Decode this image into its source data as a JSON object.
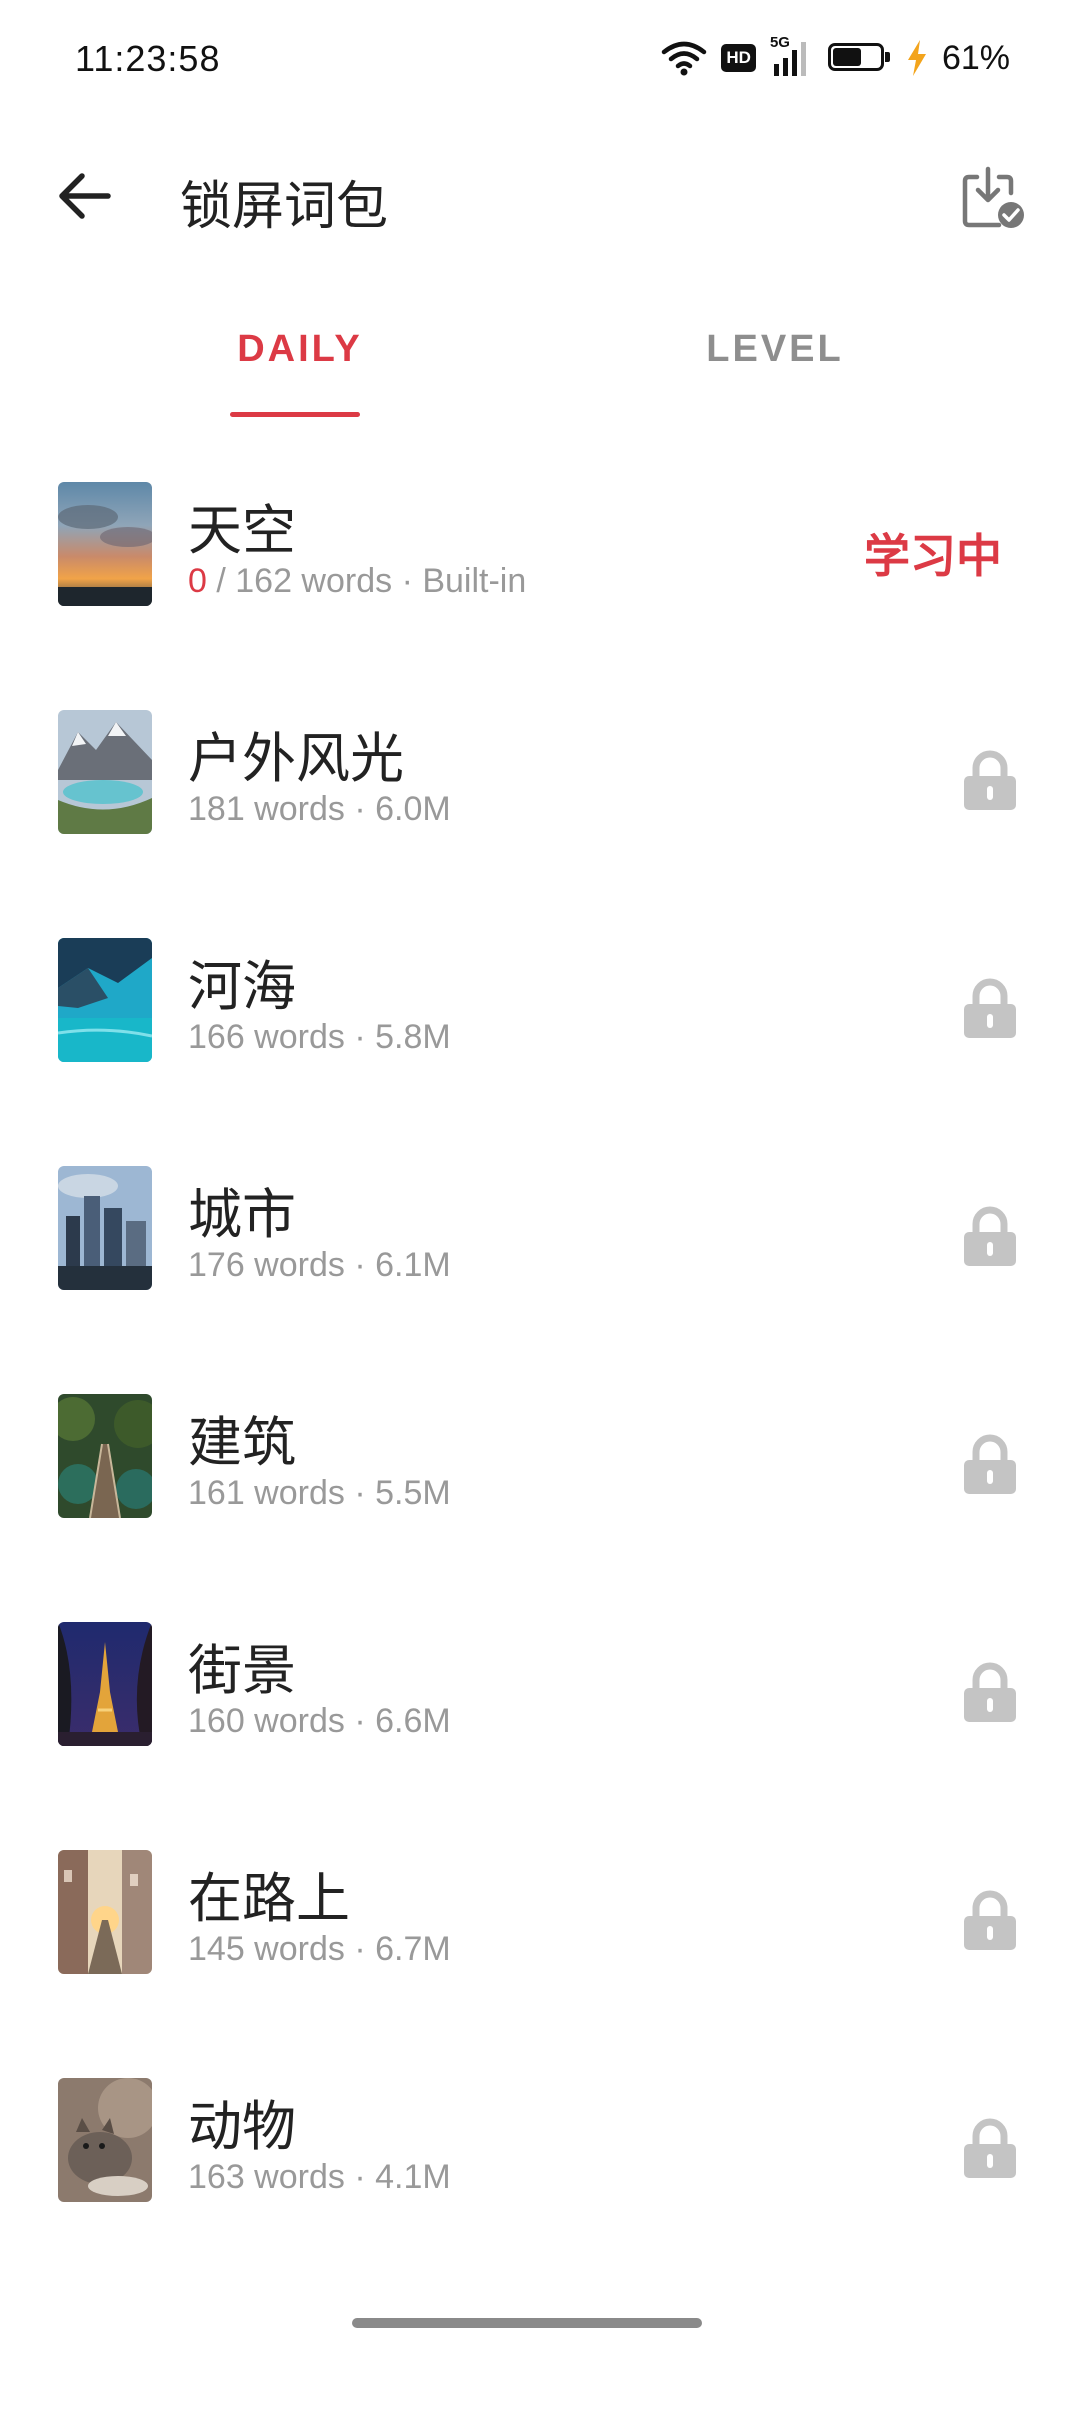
{
  "status_bar": {
    "time": "11:23:58",
    "network": "5G",
    "hd_badge": "HD",
    "battery_percent": "61%",
    "battery_level": 0.61,
    "charging": true,
    "icons": [
      "wifi-icon",
      "hd-icon",
      "signal-5g-icon",
      "battery-icon",
      "charging-bolt-icon"
    ]
  },
  "header": {
    "title": "锁屏词包",
    "back_icon": "arrow-left-icon",
    "action_icon": "download-check-icon"
  },
  "tabs": [
    {
      "label": "DAILY",
      "active": true
    },
    {
      "label": "LEVEL",
      "active": false
    }
  ],
  "colors": {
    "accent": "#dc3a45",
    "muted_text": "#999999",
    "lock": "#c4c4c4"
  },
  "packs": [
    {
      "title": "天空",
      "learned": "0",
      "sub_rest": " / 162 words · Built-in",
      "status": "学习中",
      "locked": false
    },
    {
      "title": "户外风光",
      "subtitle": "181 words · 6.0M",
      "locked": true
    },
    {
      "title": "河海",
      "subtitle": "166 words · 5.8M",
      "locked": true
    },
    {
      "title": "城市",
      "subtitle": "176 words · 6.1M",
      "locked": true
    },
    {
      "title": "建筑",
      "subtitle": "161 words · 5.5M",
      "locked": true
    },
    {
      "title": "街景",
      "subtitle": "160 words · 6.6M",
      "locked": true
    },
    {
      "title": "在路上",
      "subtitle": "145 words · 6.7M",
      "locked": true
    },
    {
      "title": "动物",
      "subtitle": "163 words · 4.1M",
      "locked": true
    }
  ]
}
